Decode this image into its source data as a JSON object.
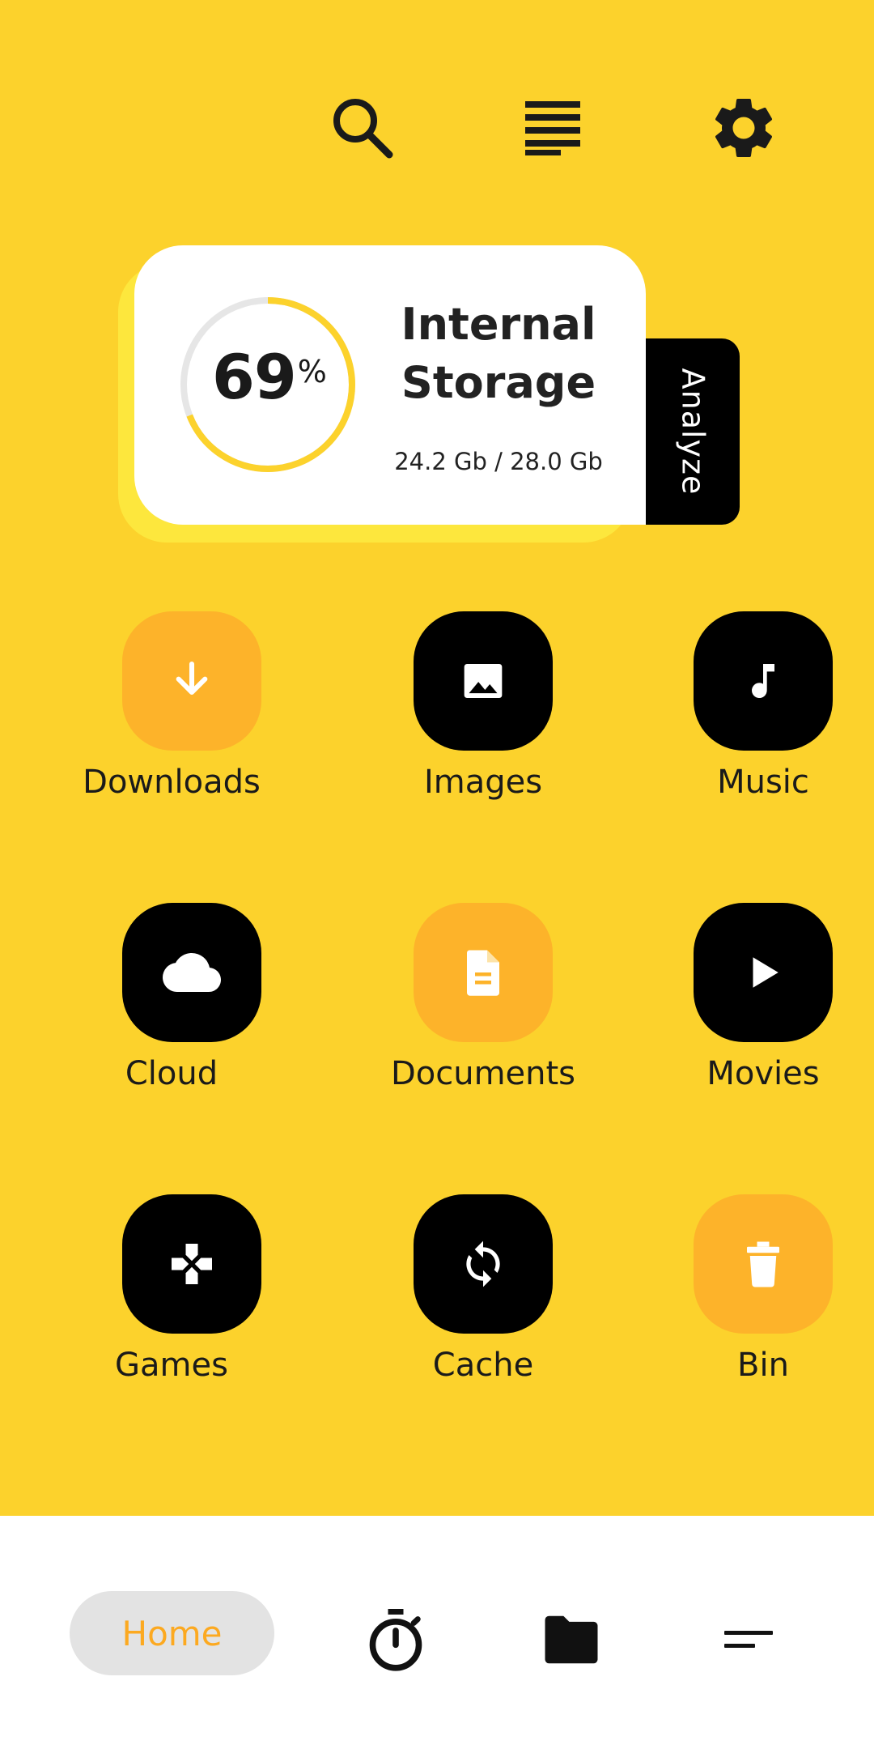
{
  "toolbar": {
    "search_icon": "search-icon",
    "list_icon": "list-icon",
    "settings_icon": "gear-icon"
  },
  "storage": {
    "percent": "69",
    "percent_sign": "%",
    "percent_value": 0.69,
    "title_line1": "Internal",
    "title_line2": "Storage",
    "usage": "24.2 Gb / 28.0 Gb",
    "analyze_label": "Analyze"
  },
  "categories": [
    {
      "label": "Downloads",
      "icon": "download-icon",
      "style": "light"
    },
    {
      "label": "Images",
      "icon": "image-icon",
      "style": "dark"
    },
    {
      "label": "Music",
      "icon": "music-note-icon",
      "style": "dark"
    },
    {
      "label": "Cloud",
      "icon": "cloud-icon",
      "style": "dark"
    },
    {
      "label": "Documents",
      "icon": "document-icon",
      "style": "light"
    },
    {
      "label": "Movies",
      "icon": "play-icon",
      "style": "dark"
    },
    {
      "label": "Games",
      "icon": "gamepad-icon",
      "style": "dark"
    },
    {
      "label": "Cache",
      "icon": "sync-icon",
      "style": "dark"
    },
    {
      "label": "Bin",
      "icon": "trash-icon",
      "style": "light"
    }
  ],
  "bottom_nav": {
    "home_label": "Home",
    "timer_icon": "stopwatch-icon",
    "folder_icon": "folder-icon",
    "sort_icon": "sort-icon"
  },
  "colors": {
    "background": "#FCD22C",
    "accent_orange": "#FDB32A",
    "home_text": "#FCA920",
    "ring_progress": "#FCD22C",
    "ring_track": "#E6E6E6"
  }
}
